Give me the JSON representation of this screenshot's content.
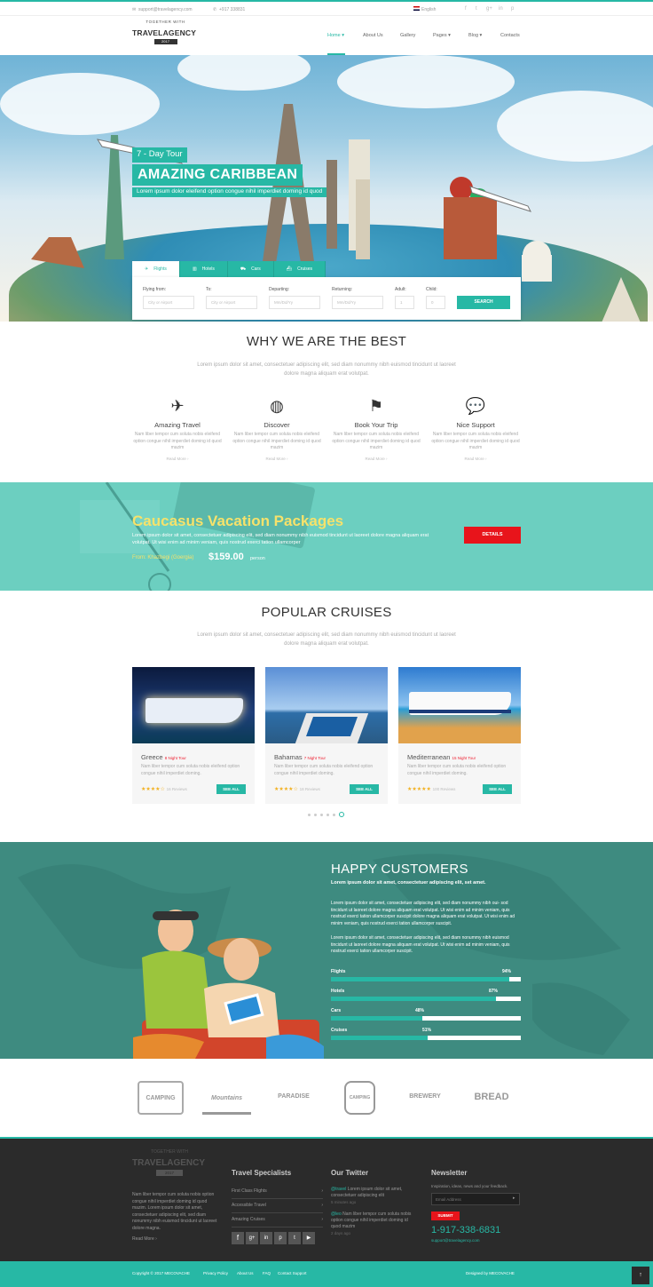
{
  "topbar": {
    "email": "support@travelagency.com",
    "phone": "+917 338831",
    "language": "English",
    "social": [
      "f",
      "t",
      "g+",
      "in",
      "p"
    ]
  },
  "brand": {
    "tagline": "TOGETHER WITH",
    "name": "TRAVELAGENCY",
    "badge": "2017"
  },
  "nav": [
    {
      "label": "Home ▾"
    },
    {
      "label": "About Us"
    },
    {
      "label": "Gallery"
    },
    {
      "label": "Pages ▾"
    },
    {
      "label": "Blog ▾"
    },
    {
      "label": "Contacts"
    }
  ],
  "hero": {
    "tag": "7 - Day Tour",
    "title": "AMAZING CARIBBEAN",
    "subtitle": "Lorem ipsum dolor eleifend option congue nihil imperdiet doming id quod"
  },
  "search": {
    "tabs": [
      "Flights",
      "Hotels",
      "Cars",
      "Cruises"
    ],
    "fields": [
      {
        "label": "Flying from:",
        "placeholder": "City or Airport"
      },
      {
        "label": "To:",
        "placeholder": "City or Airport"
      },
      {
        "label": "Departing:",
        "placeholder": "Mm/Dd/Yy"
      },
      {
        "label": "Returning:",
        "placeholder": "Mm/Dd/Yy"
      },
      {
        "label": "Adult:",
        "placeholder": "1"
      },
      {
        "label": "Child:",
        "placeholder": "0"
      }
    ],
    "button": "SEARCH"
  },
  "why": {
    "title": "WHY WE ARE THE BEST",
    "text": "Lorem ipsum dolor sit amet, consectetuer adipiscing elit, sed diam nonummy nibh euismod tincidunt ut laoreet dolore magna aliquam erat volutpat.",
    "features": [
      {
        "icon": "plane-globe-icon",
        "title": "Amazing Travel",
        "text": "Nam liber tempor cum soluta nobis eleifend option congue nihil imperdiet doming id quod mazim",
        "more": "Read More ›"
      },
      {
        "icon": "globe-icon",
        "title": "Discover",
        "text": "Nam liber tempor cum soluta nobis eleifend option congue nihil imperdiet doming id quod mazim",
        "more": "Read More ›"
      },
      {
        "icon": "flag-icon",
        "title": "Book Your Trip",
        "text": "Nam liber tempor cum soluta nobis eleifend option congue nihil imperdiet doming id quod mazim",
        "more": "Read More ›"
      },
      {
        "icon": "chat-icon",
        "title": "Nice Support",
        "text": "Nam liber tempor cum soluta nobis eleifend option congue nihil imperdiet doming id quod mazim",
        "more": "Read More ›"
      }
    ]
  },
  "promo": {
    "title": "Caucasus Vacation Packages",
    "text": "Lorem ipsum dolor sit amet, consectetuer adipiscing elit, sed diam nonummy nibh euismod tincidunt ut laoreet dolore magna aliquam erat volutpat. Ut wisi enim ad minim veniam, quis nostrud exerci tation ullamcorper",
    "from": "From: Khazbegi (Goergia)",
    "price": "$159.00",
    "unit": "person",
    "button": "DETAILS"
  },
  "cruises": {
    "title": "POPULAR CRUISES",
    "text": "Lorem ipsum dolor sit amet, consectetuer adipiscing elit, sed diam nonummy nibh euismod tincidunt ut laoreet dolore magna aliquam erat volutpat.",
    "items": [
      {
        "name": "Greece",
        "tour": "8 Night Tour",
        "text": "Nam liber tempor cum soluta nobis eleifend option congue nihil imperdiet doming.",
        "stars": "★★★★☆",
        "reviews": "16 Reviews",
        "button": "SEE ALL",
        "rating": 4
      },
      {
        "name": "Bahamas",
        "tour": "7 Night Tour",
        "text": "Nam liber tempor cum soluta nobis eleifend option congue nihil imperdiet doming.",
        "stars": "★★★★☆",
        "reviews": "18 Reviews",
        "button": "SEE ALL",
        "rating": 4
      },
      {
        "name": "Mediterranean",
        "tour": "15 Night Tour",
        "text": "Nam liber tempor cum soluta nobis eleifend option congue nihil imperdiet doming.",
        "stars": "★★★★★",
        "reviews": "100 Reviews",
        "button": "SEE ALL",
        "rating": 5
      }
    ]
  },
  "happy": {
    "title": "HAPPY CUSTOMERS",
    "lead": "Lorem ipsum dolor sit amet, consectetuer adipiscing elit, set amet.",
    "p1": "Lorem ipsum dolor sit amet, consectetuer adipiscing elit, sed diam nonummy nibh oui- sod tincidunt ut laoreet dolore magna aliquam erat volutpat. Ut wisi enim ad minim veniam, quis nostrud exerci tation ullamcorper suscipit dolore magna aliquam erat volutpat. Ut wisi enim ad minim veniam, quis nostrud exerci tation ullamcorper suscipit.",
    "p2": "Lorem ipsum dolor sit amet, consectetuer adipiscing elit, sed diam nonummy nibh euismod tincidunt ut laoreet dolore magna aliquam erat volutpat. Ut wisi enim ad minim veniam, quis nostrud exerci tation ullamcorper suscipit.",
    "bars": [
      {
        "label": "Flights",
        "pct": "94%",
        "value": 94
      },
      {
        "label": "Hotels",
        "pct": "87%",
        "value": 87
      },
      {
        "label": "Cars",
        "pct": "48%",
        "value": 48
      },
      {
        "label": "Cruises",
        "pct": "51%",
        "value": 51
      }
    ]
  },
  "partners": [
    "CAMPING",
    "Mountains",
    "PARADISE",
    "CAMPING",
    "BREWERY",
    "BREAD"
  ],
  "footer": {
    "about": "Nam liber tempor cum soluta nobis option congue nihil imperdiet doming id quod mazim. Lorem ipsum dolor sit amet, consectetuer adipiscing elit, sed diam nonummy nibh euismod tincidunt ut laoreet dolore magna.",
    "more": "Read More ›",
    "col2": "Travel Specialists",
    "links": [
      "First Class Flights",
      "Accessible Travel",
      "Amazing Cruises"
    ],
    "col3": "Our Twitter",
    "tweets": [
      {
        "user": "@travel",
        "text": "Lorem ipsum dolor sit amet, consectetuer adipiscing elit",
        "time": "5 minutes ago"
      },
      {
        "user": "@leo",
        "text": "Nam liber tempor cum soluta nobis option congue nihil imperdiet doming id quod mazim",
        "time": "2 days ago"
      }
    ],
    "col4": "Newsletter",
    "news_text": "Inspiration, ideas, news and your feedback.",
    "email_ph": "Email Address",
    "subscribe": "SUBMIT",
    "phone": "1-917-338-6831",
    "email": "support@travelagency.com"
  },
  "copyright": {
    "left": "Copyright © 2017 MECOVACHE",
    "links": [
      "Privacy Policy",
      "About Us",
      "FAQ",
      "Contact Support"
    ],
    "right": "Designed by MECOVACHE"
  },
  "colors": {
    "accent": "#27b8a5",
    "red": "#e8141b",
    "dark": "#2b2b2b"
  }
}
